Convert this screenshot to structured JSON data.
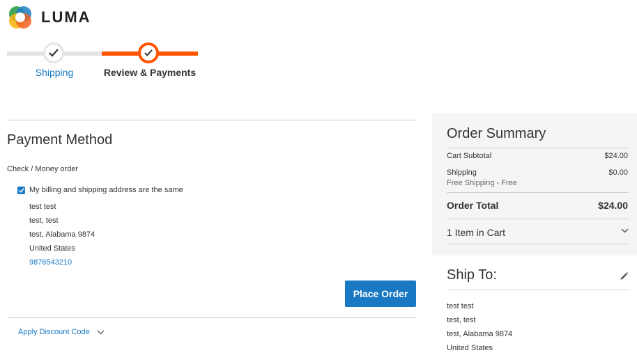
{
  "brand": {
    "name": "LUMA"
  },
  "colors": {
    "accent": "#1979c3",
    "progress": "#ff5501",
    "summary_bg": "#f5f5f5"
  },
  "progress": {
    "steps": [
      {
        "label": "Shipping",
        "state": "completed"
      },
      {
        "label": "Review & Payments",
        "state": "active"
      }
    ]
  },
  "payment": {
    "title": "Payment Method",
    "method_name": "Check / Money order",
    "billing_same_label": "My billing and shipping address are the same",
    "billing_same_checked": true,
    "address": {
      "name": "test test",
      "street": "test, test",
      "city_region": "test, Alabama 9874",
      "country": "United States",
      "phone": "9876543210"
    },
    "place_order_label": "Place Order",
    "discount_label": "Apply Discount Code"
  },
  "summary": {
    "title": "Order Summary",
    "cart_subtotal_label": "Cart Subtotal",
    "cart_subtotal_value": "$24.00",
    "shipping_label": "Shipping",
    "shipping_value": "$0.00",
    "shipping_method": "Free Shipping - Free",
    "total_label": "Order Total",
    "total_value": "$24.00",
    "items_in_cart": "1 Item in Cart"
  },
  "ship_to": {
    "title": "Ship To:",
    "name": "test test",
    "street": "test, test",
    "city_region": "test, Alabama 9874",
    "country": "United States"
  }
}
